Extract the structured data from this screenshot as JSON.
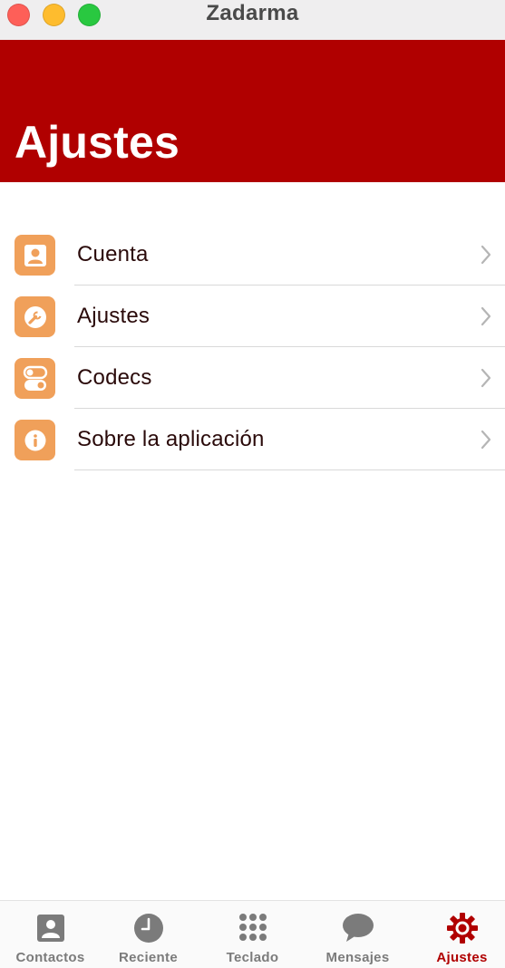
{
  "window": {
    "title": "Zadarma"
  },
  "header": {
    "title": "Ajustes",
    "background_color": "#b00000"
  },
  "menu": {
    "items": [
      {
        "label": "Cuenta",
        "icon": "person-icon"
      },
      {
        "label": "Ajustes",
        "icon": "wrench-icon"
      },
      {
        "label": "Codecs",
        "icon": "toggles-icon"
      },
      {
        "label": "Sobre la aplicación",
        "icon": "info-icon"
      }
    ],
    "icon_color": "#f0a05a"
  },
  "tabbar": {
    "active_color": "#b00000",
    "inactive_color": "#7b7b7b",
    "tabs": [
      {
        "label": "Contactos",
        "icon": "contact-card-icon",
        "active": false
      },
      {
        "label": "Reciente",
        "icon": "clock-icon",
        "active": false
      },
      {
        "label": "Teclado",
        "icon": "keypad-icon",
        "active": false
      },
      {
        "label": "Mensajes",
        "icon": "chat-bubble-icon",
        "active": false
      },
      {
        "label": "Ajustes",
        "icon": "gear-icon",
        "active": true
      }
    ]
  }
}
